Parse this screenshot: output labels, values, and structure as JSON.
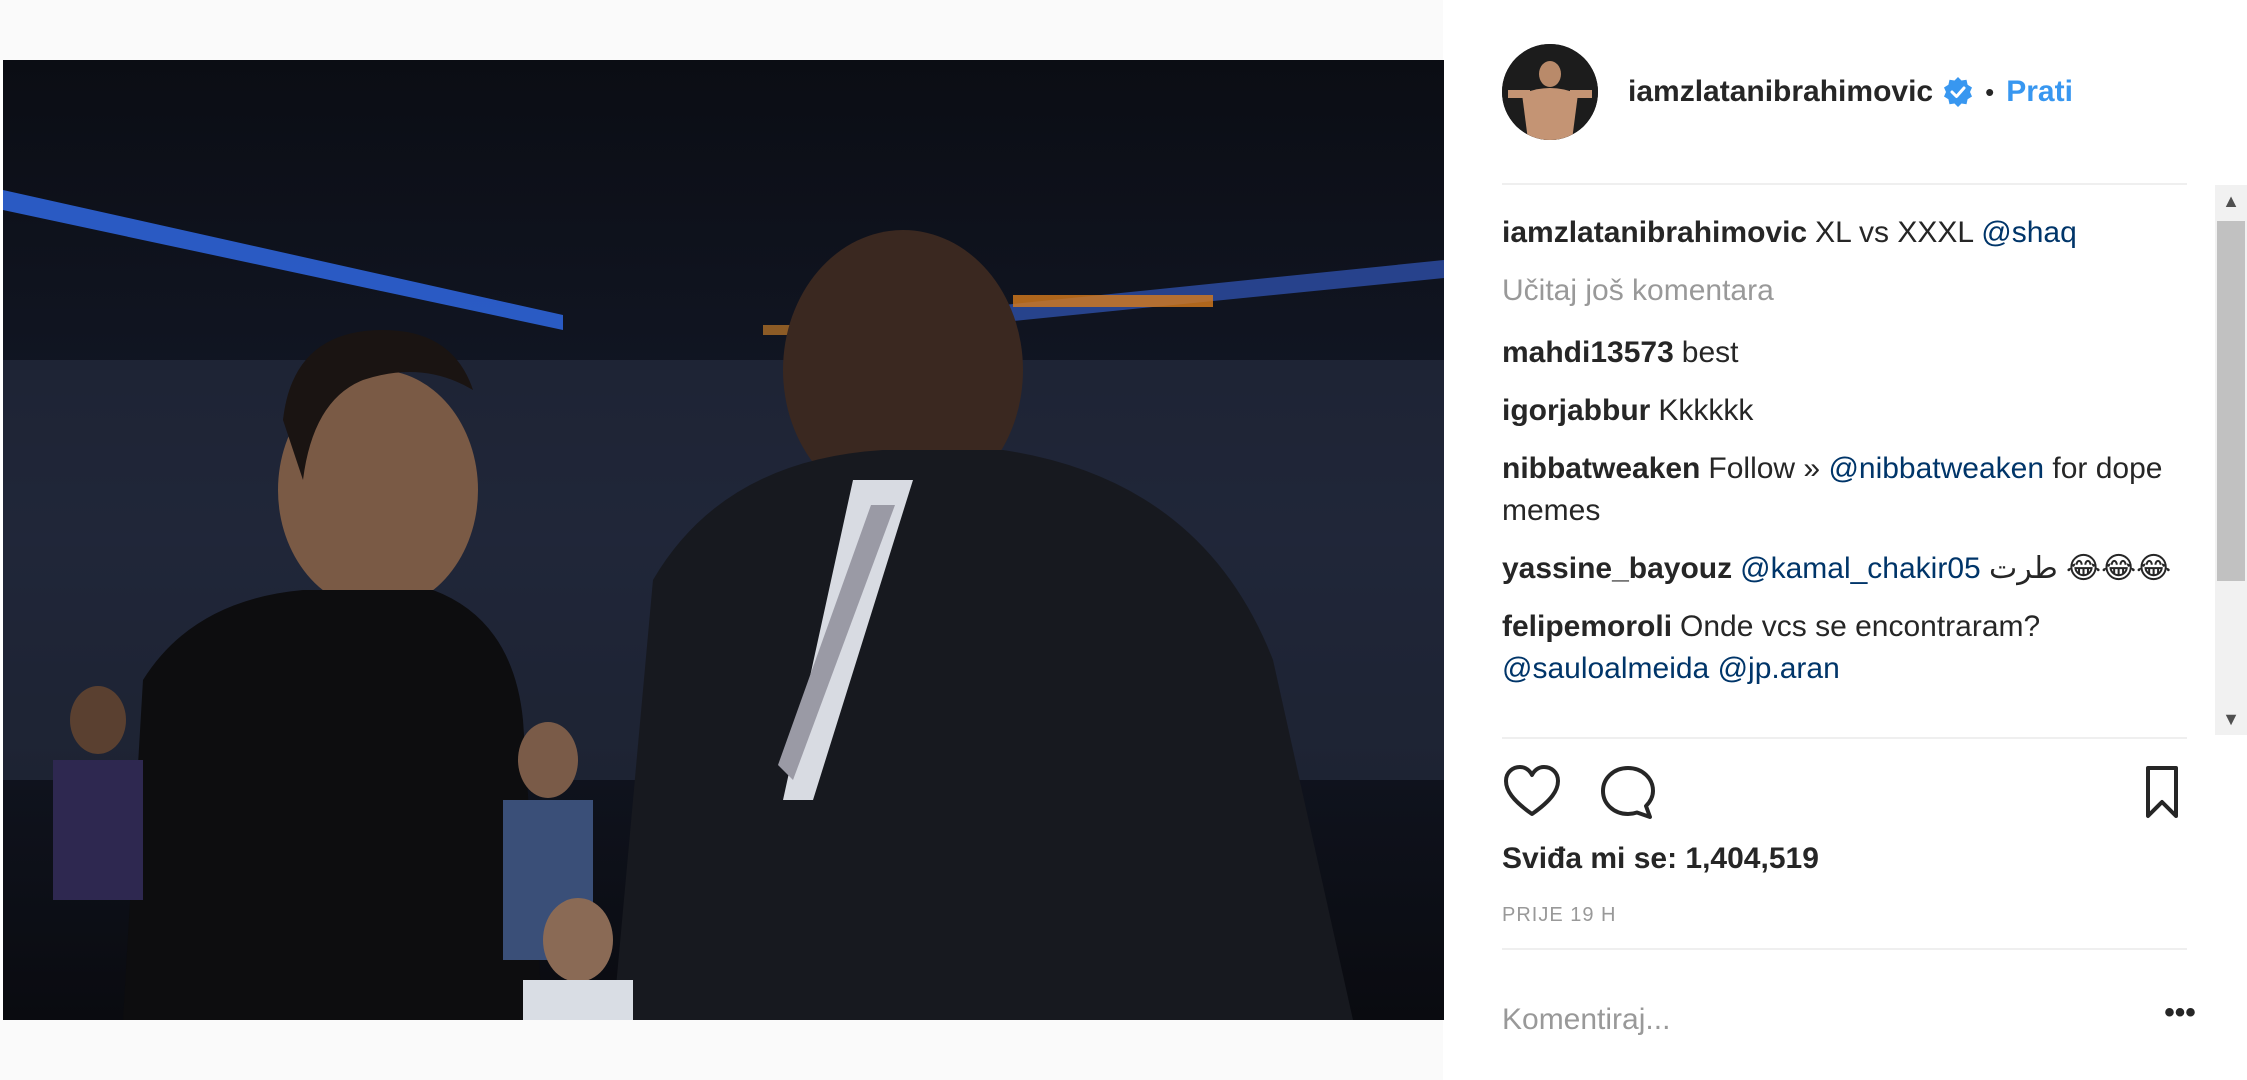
{
  "post": {
    "username": "iamzlatanibrahimovic",
    "separator": "•",
    "follow_label": "Prati",
    "verified_icon": "verified-badge-icon"
  },
  "caption": {
    "author": "iamzlatanibrahimovic",
    "text": "XL vs XXXL ",
    "mention": "@shaq"
  },
  "load_more_label": "Učitaj još komentara",
  "comments": [
    {
      "author": "mahdi13573",
      "text": "best"
    },
    {
      "author": "igorjabbur",
      "text": "Kkkkkk"
    },
    {
      "author": "nibbatweaken",
      "text": "Follow » ",
      "mention": "@nibbatweaken",
      "text_after": " for dope memes"
    },
    {
      "author": "yassine_bayouz",
      "mention": "@kamal_chakir05",
      "text_after": " طرت 😂😂😂"
    },
    {
      "author": "felipemoroli",
      "text": "Onde vcs se encontraram? ",
      "mention": "@sauloalmeida",
      "text_after": "  ",
      "mention2": "@jp.aran"
    }
  ],
  "likes_label": "Sviđa mi se: 1,404,519",
  "timestamp": "PRIJE 19 H",
  "comment_input": {
    "placeholder": "Komentiraj..."
  },
  "more_options_label": "•••",
  "icons": {
    "like": "heart-icon",
    "comment": "speech-bubble-icon",
    "save": "bookmark-icon"
  },
  "colors": {
    "link": "#3897f0",
    "mention": "#003569",
    "muted": "#999999",
    "text": "#262626"
  }
}
